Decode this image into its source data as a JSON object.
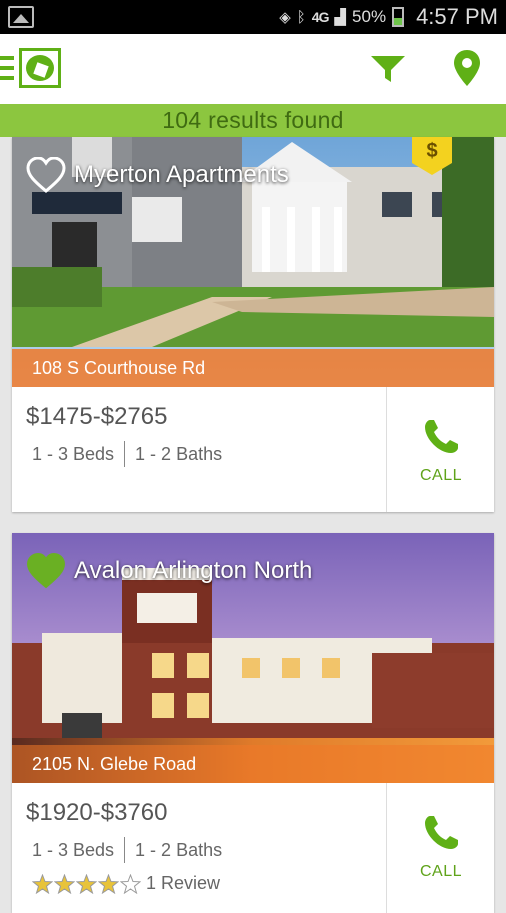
{
  "status_bar": {
    "network": "4G",
    "battery_percent": "50%",
    "time": "4:57 PM"
  },
  "app_bar": {
    "icons": [
      "menu-icon",
      "logo-icon",
      "filter-icon",
      "location-pin-icon"
    ],
    "accent_color": "#5fb016"
  },
  "results": {
    "text": "104 results found",
    "color": "#8cc63f"
  },
  "listings": [
    {
      "name": "Myerton Apartments",
      "address": "108 S Courthouse Rd",
      "price": "$1475-$2765",
      "beds": "1 - 3 Beds",
      "baths": "1 - 2 Baths",
      "favorite": false,
      "price_badge": "$",
      "call_label": "CALL"
    },
    {
      "name": "Avalon Arlington North",
      "address": "2105 N. Glebe Road",
      "price": "$1920-$3760",
      "beds": "1 - 3 Beds",
      "baths": "1 - 2 Baths",
      "favorite": true,
      "rating_stars": 4,
      "rating_max": 5,
      "reviews": "1 Review",
      "call_label": "CALL"
    }
  ]
}
